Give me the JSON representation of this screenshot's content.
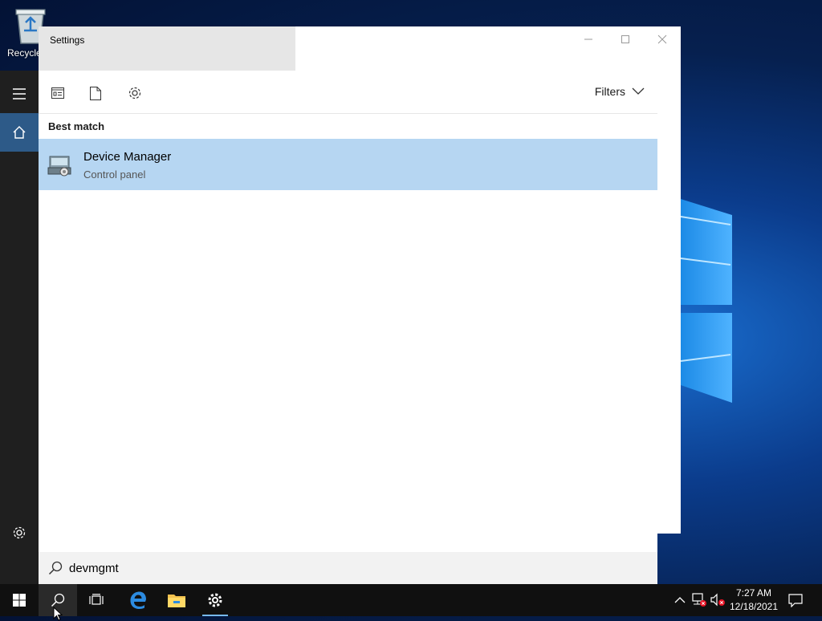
{
  "desktop": {
    "recycle_bin_label": "Recycle"
  },
  "window": {
    "title": "Settings"
  },
  "search": {
    "filters_label": "Filters",
    "section_title": "Best match",
    "result": {
      "name": "Device Manager",
      "type": "Control panel"
    },
    "query": "devmgmt"
  },
  "taskbar": {
    "time": "7:27 AM",
    "date": "12/18/2021"
  },
  "icons": {
    "rail": [
      "menu-icon",
      "home-icon",
      "settings-icon"
    ],
    "toolbar": [
      "apps-filter-icon",
      "documents-filter-icon",
      "settings-filter-icon",
      "chevron-down-icon"
    ],
    "taskbar": [
      "start-icon",
      "search-icon",
      "task-view-icon",
      "edge-icon",
      "file-explorer-icon",
      "settings-icon"
    ],
    "tray": [
      "chevron-up-icon",
      "network-icon",
      "volume-icon",
      "action-center-icon"
    ]
  },
  "colors": {
    "accent": "#2d5a88",
    "selection": "#b6d6f2",
    "taskbar": "#101010",
    "rail": "#1f1f1f"
  }
}
